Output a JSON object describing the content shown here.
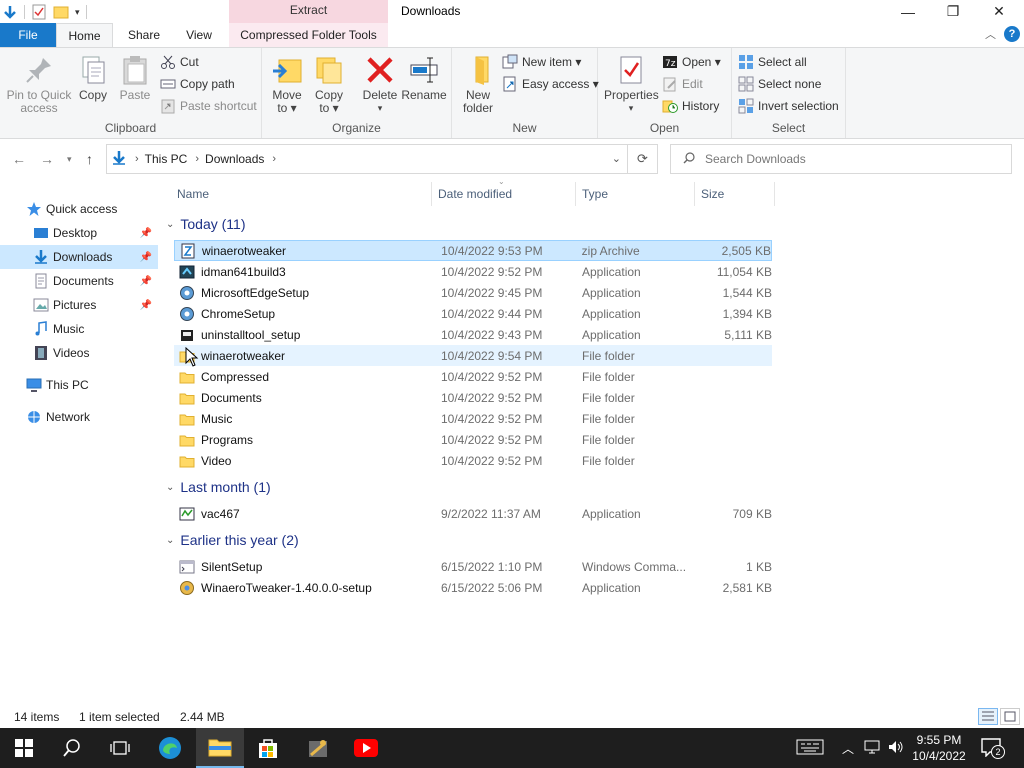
{
  "window": {
    "title": "Downloads",
    "context_group": "Extract",
    "controls": {
      "minimize": "—",
      "restore": "❐",
      "close": "✕"
    }
  },
  "ribbon_tabs": {
    "file": "File",
    "home": "Home",
    "share": "Share",
    "view": "View",
    "compressed_tools": "Compressed Folder Tools",
    "help": "?"
  },
  "ribbon": {
    "clipboard": {
      "label": "Clipboard",
      "pin_line1": "Pin to Quick",
      "pin_line2": "access",
      "copy": "Copy",
      "paste": "Paste",
      "cut": "Cut",
      "copy_path": "Copy path",
      "paste_shortcut": "Paste shortcut"
    },
    "organize": {
      "label": "Organize",
      "move_line1": "Move",
      "move_line2": "to ▾",
      "copy_line1": "Copy",
      "copy_line2": "to ▾",
      "delete_line1": "Delete",
      "delete_line2": "▾",
      "rename": "Rename"
    },
    "new": {
      "label": "New",
      "new_folder_line1": "New",
      "new_folder_line2": "folder",
      "new_item": "New item ▾",
      "easy_access": "Easy access ▾"
    },
    "open": {
      "label": "Open",
      "properties_line1": "Properties",
      "properties_line2": "▾",
      "open": "Open ▾",
      "edit": "Edit",
      "history": "History"
    },
    "select": {
      "label": "Select",
      "select_all": "Select all",
      "select_none": "Select none",
      "invert": "Invert selection"
    }
  },
  "address": {
    "crumbs": [
      "This PC",
      "Downloads"
    ],
    "search_placeholder": "Search Downloads"
  },
  "nav": {
    "quick_access": "Quick access",
    "desktop": "Desktop",
    "downloads": "Downloads",
    "documents": "Documents",
    "pictures": "Pictures",
    "music": "Music",
    "videos": "Videos",
    "this_pc": "This PC",
    "network": "Network"
  },
  "columns": {
    "name": "Name",
    "date": "Date modified",
    "type": "Type",
    "size": "Size"
  },
  "groups": [
    {
      "title": "Today (11)",
      "files": [
        {
          "name": "winaerotweaker",
          "date": "10/4/2022 9:53 PM",
          "type": "zip Archive",
          "size": "2,505 KB",
          "icon": "zip-icon"
        },
        {
          "name": "idman641build3",
          "date": "10/4/2022 9:52 PM",
          "type": "Application",
          "size": "11,054 KB",
          "icon": "app-icon"
        },
        {
          "name": "MicrosoftEdgeSetup",
          "date": "10/4/2022 9:45 PM",
          "type": "Application",
          "size": "1,544 KB",
          "icon": "setup-icon"
        },
        {
          "name": "ChromeSetup",
          "date": "10/4/2022 9:44 PM",
          "type": "Application",
          "size": "1,394 KB",
          "icon": "setup-icon"
        },
        {
          "name": "uninstalltool_setup",
          "date": "10/4/2022 9:43 PM",
          "type": "Application",
          "size": "5,111 KB",
          "icon": "box-icon"
        },
        {
          "name": "winaerotweaker",
          "date": "10/4/2022 9:54 PM",
          "type": "File folder",
          "size": "",
          "icon": "folder-icon"
        },
        {
          "name": "Compressed",
          "date": "10/4/2022 9:52 PM",
          "type": "File folder",
          "size": "",
          "icon": "folder-icon"
        },
        {
          "name": "Documents",
          "date": "10/4/2022 9:52 PM",
          "type": "File folder",
          "size": "",
          "icon": "folder-icon"
        },
        {
          "name": "Music",
          "date": "10/4/2022 9:52 PM",
          "type": "File folder",
          "size": "",
          "icon": "folder-icon"
        },
        {
          "name": "Programs",
          "date": "10/4/2022 9:52 PM",
          "type": "File folder",
          "size": "",
          "icon": "folder-icon"
        },
        {
          "name": "Video",
          "date": "10/4/2022 9:52 PM",
          "type": "File folder",
          "size": "",
          "icon": "folder-icon"
        }
      ]
    },
    {
      "title": "Last month (1)",
      "files": [
        {
          "name": "vac467",
          "date": "9/2/2022 11:37 AM",
          "type": "Application",
          "size": "709 KB",
          "icon": "app-icon"
        }
      ]
    },
    {
      "title": "Earlier this year (2)",
      "files": [
        {
          "name": "SilentSetup",
          "date": "6/15/2022 1:10 PM",
          "type": "Windows Comma...",
          "size": "1 KB",
          "icon": "cmd-icon"
        },
        {
          "name": "WinaeroTweaker-1.40.0.0-setup",
          "date": "6/15/2022 5:06 PM",
          "type": "Application",
          "size": "2,581 KB",
          "icon": "setup-icon"
        }
      ]
    }
  ],
  "status": {
    "items": "14 items",
    "selected": "1 item selected",
    "size": "2.44 MB"
  },
  "clock": {
    "time": "9:55 PM",
    "date": "10/4/2022"
  },
  "notifications": "2",
  "colors": {
    "accent": "#1979ca",
    "selection": "#cce8ff",
    "group_header": "#1e3287"
  }
}
